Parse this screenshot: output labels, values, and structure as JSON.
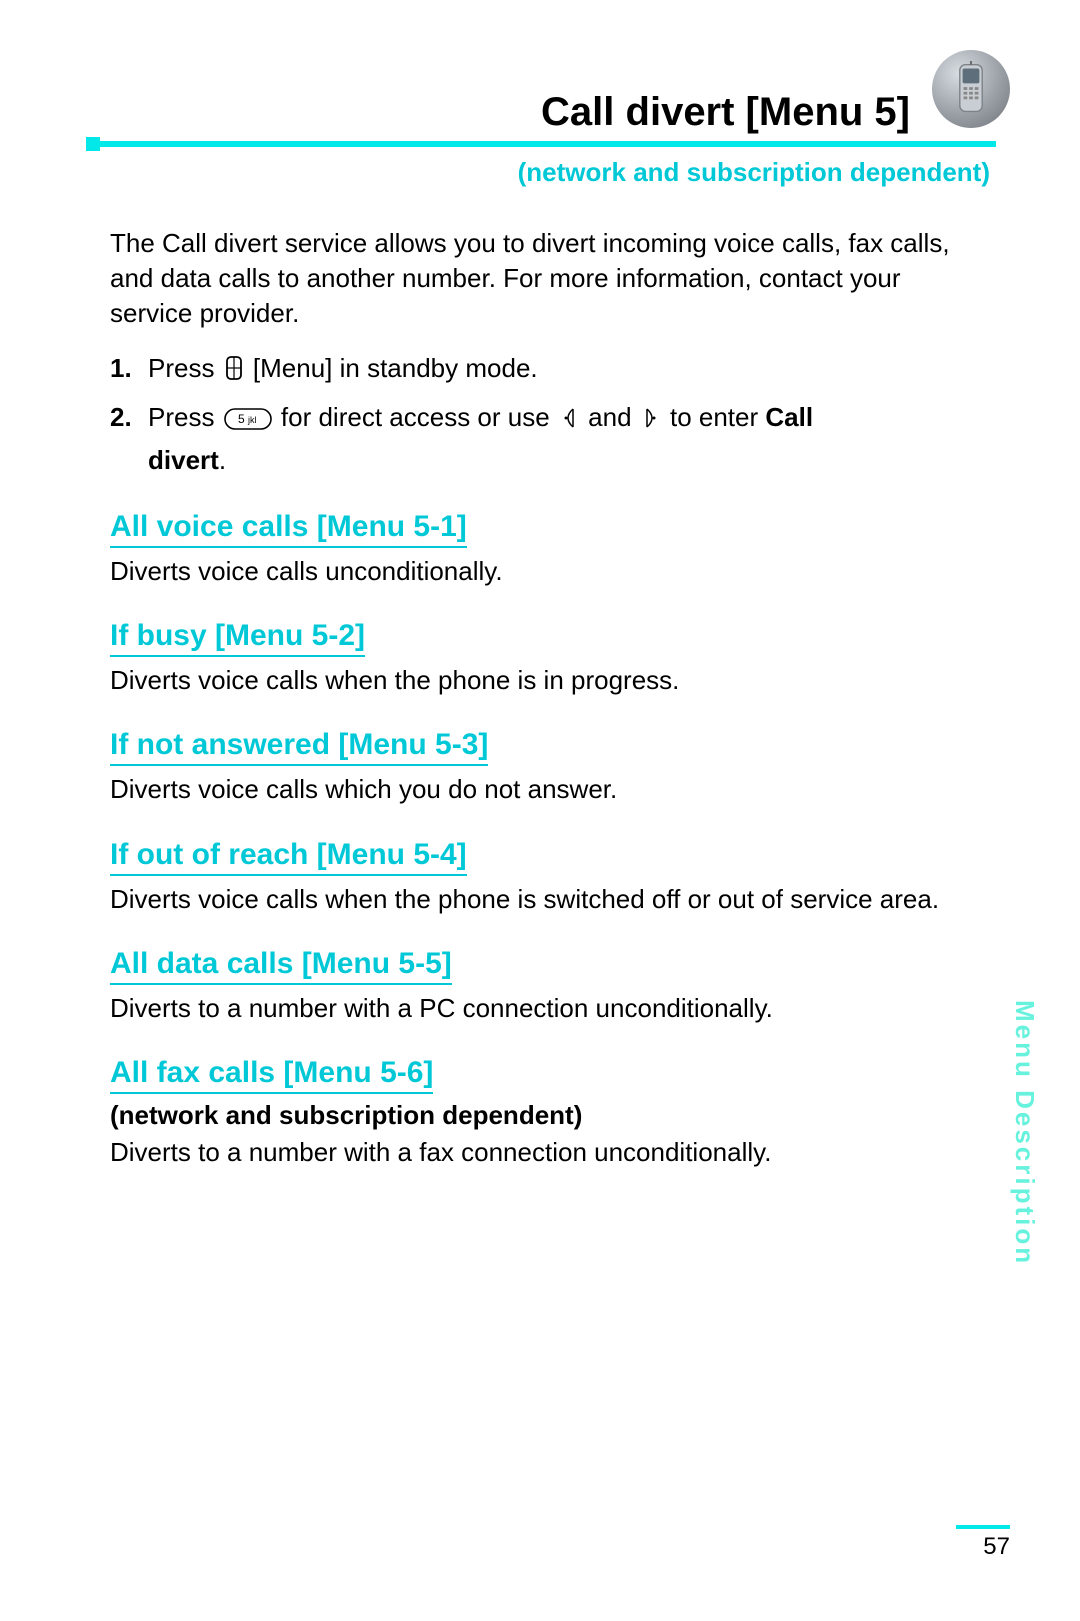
{
  "header": {
    "title": "Call divert [Menu 5]",
    "subtitle": "(network and subscription dependent)"
  },
  "intro": "The Call divert service allows you to divert incoming voice calls, fax calls, and data calls to another number. For more information, contact your service provider.",
  "steps": [
    {
      "num": "1.",
      "text_before": "Press ",
      "text_after": " [Menu] in standby mode."
    },
    {
      "num": "2.",
      "text_before": "Press ",
      "text_mid1": " for direct access or use ",
      "text_mid2": " and ",
      "text_mid3": " to enter ",
      "bold1": "Call",
      "bold2": "divert",
      "text_end": "."
    }
  ],
  "sections": [
    {
      "title": "All voice calls [Menu 5-1]",
      "body": "Diverts voice calls unconditionally."
    },
    {
      "title": "If busy [Menu 5-2]",
      "body": "Diverts voice calls when the phone is in progress."
    },
    {
      "title": "If not answered [Menu 5-3]",
      "body": "Diverts voice calls which you do not answer."
    },
    {
      "title": "If out of reach [Menu 5-4]",
      "body": "Diverts voice calls when the phone is switched off or out of service area."
    },
    {
      "title": "All data calls [Menu 5-5]",
      "body": "Diverts to a number with a PC connection unconditionally."
    },
    {
      "title": "All fax calls [Menu 5-6]",
      "note": "(network and subscription dependent)",
      "body": "Diverts to a number with a fax connection unconditionally."
    }
  ],
  "side_label": "Menu Description",
  "page_number": "57"
}
